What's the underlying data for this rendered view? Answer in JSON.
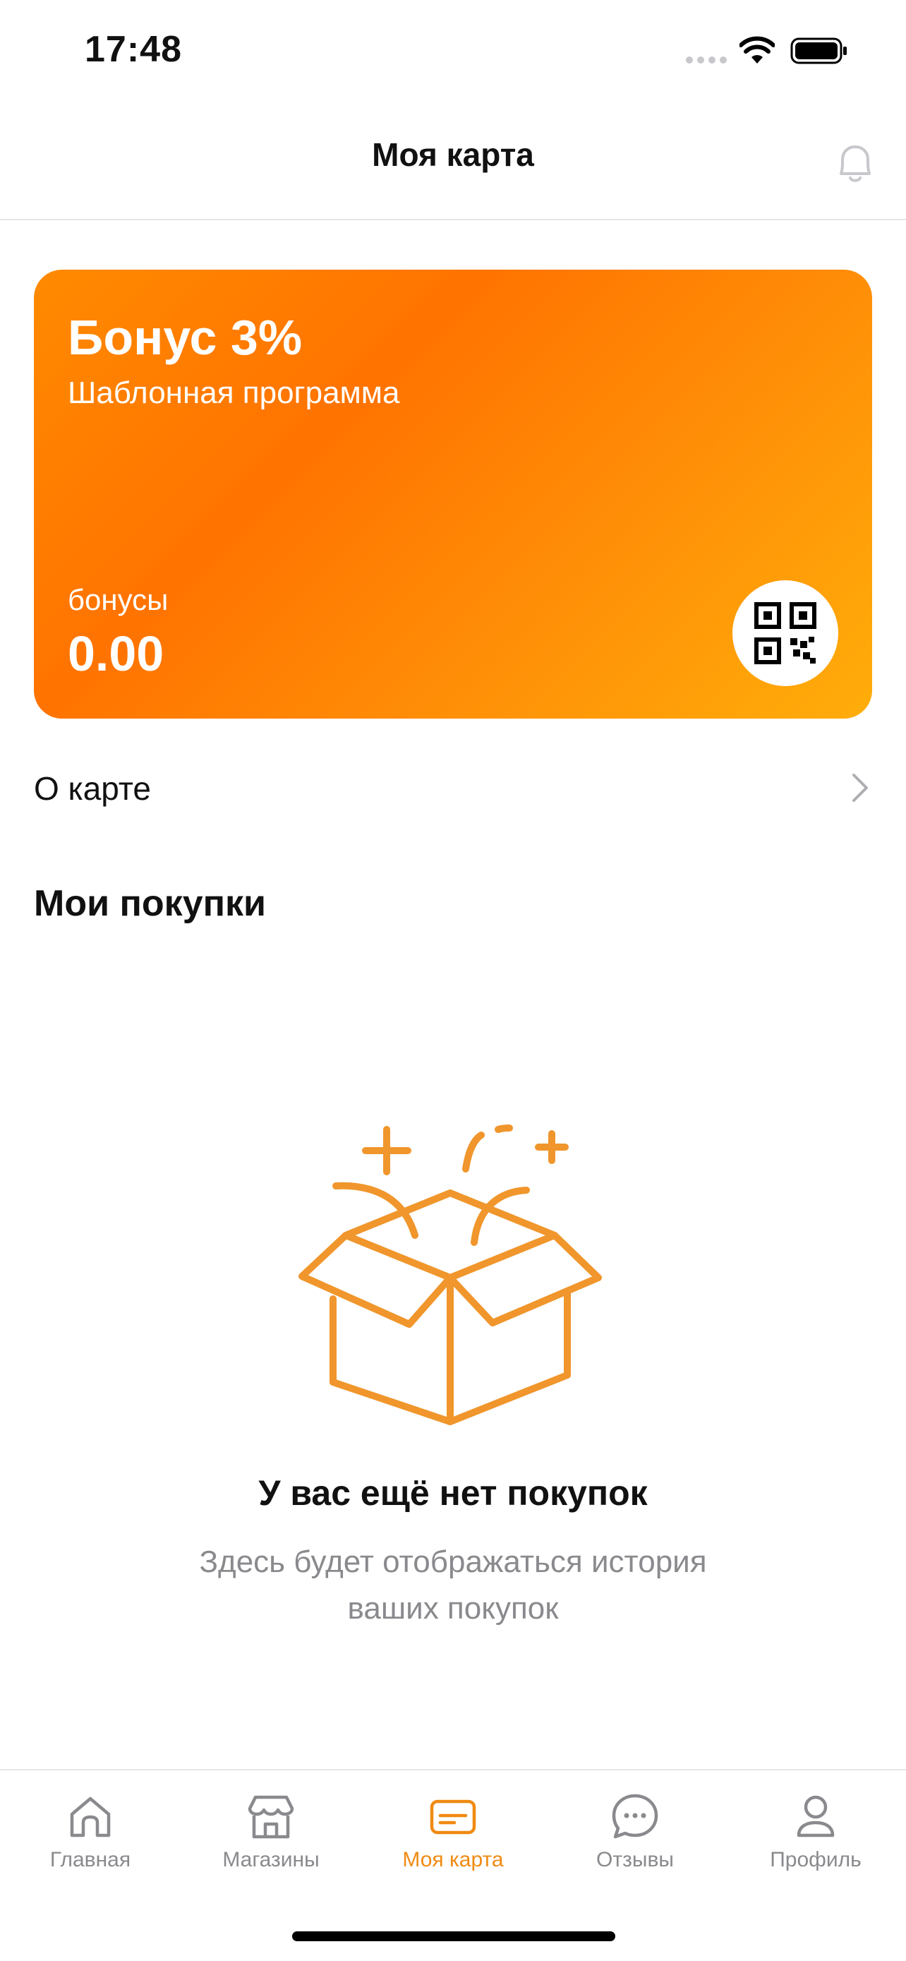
{
  "status_bar": {
    "time": "17:48"
  },
  "header": {
    "title": "Моя карта",
    "notification_icon": "bell-icon"
  },
  "card": {
    "title": "Бонус 3%",
    "subtitle": "Шаблонная программа",
    "bonus_label": "бонусы",
    "bonus_value": "0.00",
    "qr_icon": "qr-code-icon",
    "colors": {
      "gradient_start": "#ff7300",
      "gradient_end": "#ffad0a"
    }
  },
  "about_row": {
    "label": "О карте",
    "icon": "chevron-right-icon"
  },
  "purchases": {
    "title": "Мои покупки",
    "empty_title": "У вас ещё нет покупок",
    "empty_description": "Здесь будет отображаться история ваших покупок",
    "illustration_icon": "open-box-icon"
  },
  "tab_bar": {
    "items": [
      {
        "label": "Главная",
        "icon": "home-icon",
        "active": false
      },
      {
        "label": "Магазины",
        "icon": "store-icon",
        "active": false
      },
      {
        "label": "Моя карта",
        "icon": "card-icon",
        "active": true
      },
      {
        "label": "Отзывы",
        "icon": "chat-bubble-icon",
        "active": false
      },
      {
        "label": "Профиль",
        "icon": "profile-icon",
        "active": false
      }
    ],
    "active_color": "#f08a12",
    "inactive_color": "#8a8a8e"
  }
}
